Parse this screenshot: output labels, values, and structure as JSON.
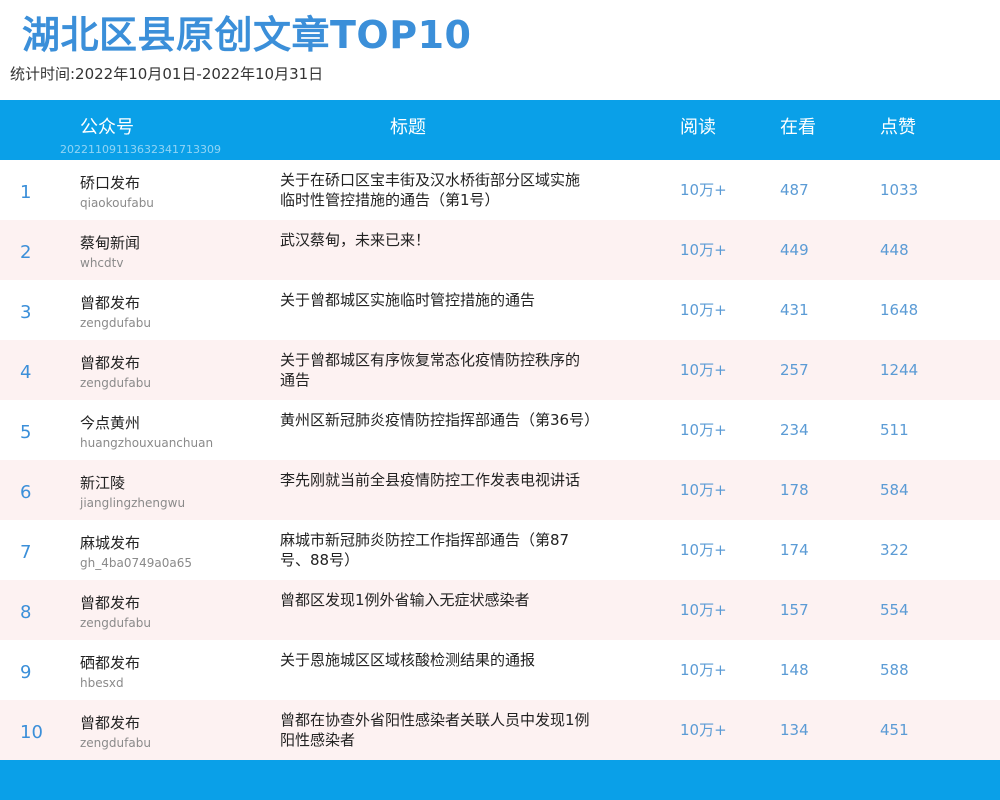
{
  "title": "湖北区县原创文章TOP10",
  "subtitle": "统计时间:2022年10月01日-2022年10月31日",
  "header": {
    "account": "公众号",
    "title": "标题",
    "read": "阅读",
    "watch": "在看",
    "like": "点赞",
    "id": "20221109113632341713309"
  },
  "rows": [
    {
      "rank": "1",
      "name": "硚口发布",
      "id": "qiaokoufabu",
      "title": "关于在硚口区宝丰街及汉水桥街部分区域实施临时性管控措施的通告（第1号）",
      "read": "10万+",
      "watch": "487",
      "like": "1033"
    },
    {
      "rank": "2",
      "name": "蔡甸新闻",
      "id": "whcdtv",
      "title": "武汉蔡甸，未来已来！",
      "read": "10万+",
      "watch": "449",
      "like": "448"
    },
    {
      "rank": "3",
      "name": "曾都发布",
      "id": "zengdufabu",
      "title": "关于曾都城区实施临时管控措施的通告",
      "read": "10万+",
      "watch": "431",
      "like": "1648"
    },
    {
      "rank": "4",
      "name": "曾都发布",
      "id": "zengdufabu",
      "title": "关于曾都城区有序恢复常态化疫情防控秩序的通告",
      "read": "10万+",
      "watch": "257",
      "like": "1244"
    },
    {
      "rank": "5",
      "name": "今点黄州",
      "id": "huangzhouxuanchuan",
      "title": "黄州区新冠肺炎疫情防控指挥部通告（第36号）",
      "read": "10万+",
      "watch": "234",
      "like": "511"
    },
    {
      "rank": "6",
      "name": "新江陵",
      "id": "jianglingzhengwu",
      "title": "李先刚就当前全县疫情防控工作发表电视讲话",
      "read": "10万+",
      "watch": "178",
      "like": "584"
    },
    {
      "rank": "7",
      "name": "麻城发布",
      "id": "gh_4ba0749a0a65",
      "title": "麻城市新冠肺炎防控工作指挥部通告（第87号、88号）",
      "read": "10万+",
      "watch": "174",
      "like": "322"
    },
    {
      "rank": "8",
      "name": "曾都发布",
      "id": "zengdufabu",
      "title": "曾都区发现1例外省输入无症状感染者",
      "read": "10万+",
      "watch": "157",
      "like": "554"
    },
    {
      "rank": "9",
      "name": "硒都发布",
      "id": "hbesxd",
      "title": "关于恩施城区区域核酸检测结果的通报",
      "read": "10万+",
      "watch": "148",
      "like": "588"
    },
    {
      "rank": "10",
      "name": "曾都发布",
      "id": "zengdufabu",
      "title": "曾都在协查外省阳性感染者关联人员中发现1例阳性感染者",
      "read": "10万+",
      "watch": "134",
      "like": "451"
    }
  ]
}
